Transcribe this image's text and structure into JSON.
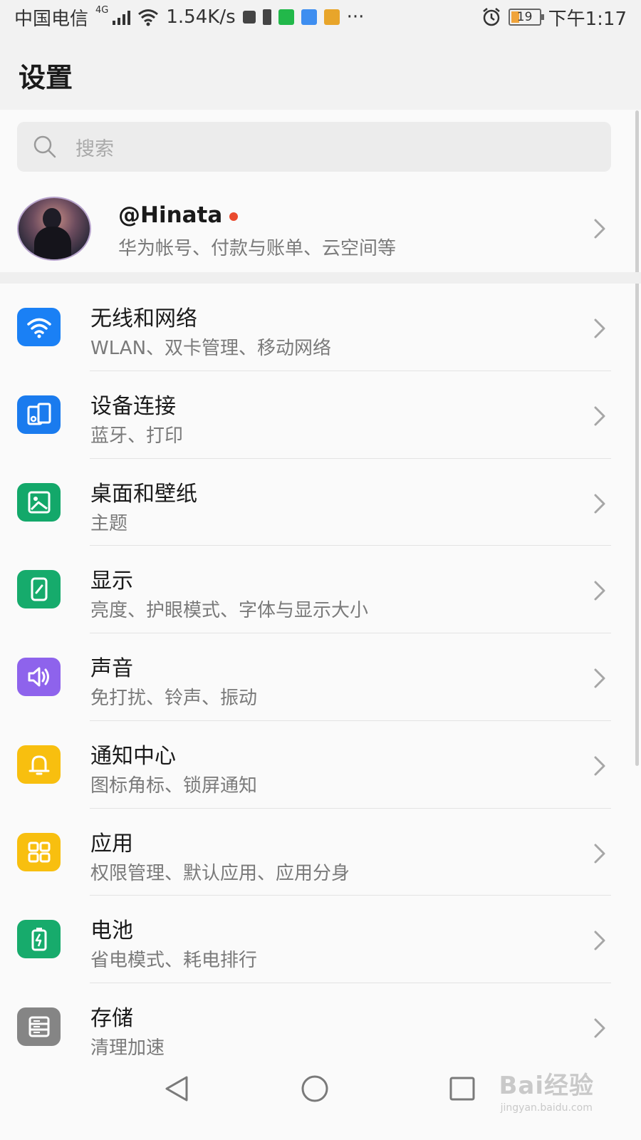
{
  "status_bar": {
    "carrier": "中国电信",
    "network_type": "4G",
    "speed": "1.54K/s",
    "more_indicator": "···",
    "battery_level": "19",
    "time": "下午1:17",
    "icons": [
      "signal-icon",
      "wifi-icon",
      "notification-icon",
      "battery-saver-icon",
      "iqiyi-app-icon",
      "maps-app-icon",
      "game-app-icon",
      "alarm-icon",
      "battery-icon"
    ]
  },
  "header": {
    "title": "设置"
  },
  "search": {
    "placeholder": "搜索"
  },
  "account": {
    "name": "@Hinata",
    "subtitle": "华为帐号、付款与账单、云空间等",
    "has_notification_dot": true
  },
  "settings": [
    {
      "title": "无线和网络",
      "subtitle": "WLAN、双卡管理、移动网络",
      "icon": "wifi-icon",
      "color": "#1a80f5"
    },
    {
      "title": "设备连接",
      "subtitle": "蓝牙、打印",
      "icon": "device-connection-icon",
      "color": "#1a7bee"
    },
    {
      "title": "桌面和壁纸",
      "subtitle": "主题",
      "icon": "wallpaper-icon",
      "color": "#13a86a"
    },
    {
      "title": "显示",
      "subtitle": "亮度、护眼模式、字体与显示大小",
      "icon": "display-icon",
      "color": "#16ab6c"
    },
    {
      "title": "声音",
      "subtitle": "免打扰、铃声、振动",
      "icon": "sound-icon",
      "color": "#8e63ec"
    },
    {
      "title": "通知中心",
      "subtitle": "图标角标、锁屏通知",
      "icon": "bell-icon",
      "color": "#f8bf0f"
    },
    {
      "title": "应用",
      "subtitle": "权限管理、默认应用、应用分身",
      "icon": "apps-icon",
      "color": "#f8bf0f"
    },
    {
      "title": "电池",
      "subtitle": "省电模式、耗电排行",
      "icon": "battery-icon",
      "color": "#17ab6c"
    },
    {
      "title": "存储",
      "subtitle": "清理加速",
      "icon": "storage-icon",
      "color": "#858585"
    }
  ],
  "nav_bar": {
    "buttons": [
      "back-icon",
      "home-icon",
      "recents-icon"
    ]
  },
  "watermark": {
    "logo": "Bai经验",
    "url": "jingyan.baidu.com"
  }
}
